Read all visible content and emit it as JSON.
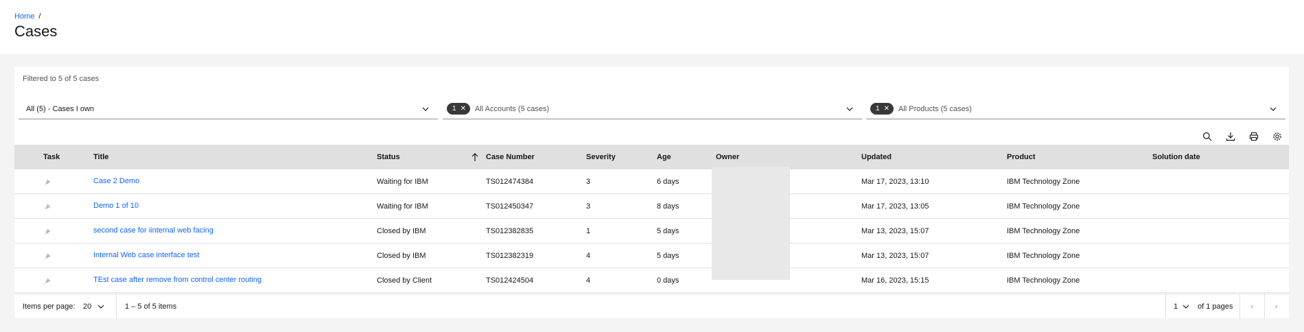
{
  "breadcrumb": {
    "home": "Home",
    "separator": "/"
  },
  "page": {
    "title": "Cases"
  },
  "filters": {
    "summary": "Filtered to 5 of 5 cases",
    "case_scope": "All (5) - Cases I own",
    "accounts": {
      "tag_count": "1",
      "label": "All Accounts (5 cases)"
    },
    "products": {
      "tag_count": "1",
      "label": "All Products (5 cases)"
    }
  },
  "toolbar": {
    "icons": [
      "search-icon",
      "download-icon",
      "print-icon",
      "settings-icon"
    ]
  },
  "table": {
    "headers": {
      "task": "Task",
      "title": "Title",
      "status": "Status",
      "case_number": "Case Number",
      "severity": "Severity",
      "age": "Age",
      "owner": "Owner",
      "updated": "Updated",
      "product": "Product",
      "solution_date": "Solution date"
    },
    "sort": {
      "column": "status",
      "direction": "ascending"
    },
    "rows": [
      {
        "title": "Case 2 Demo",
        "status": "Waiting for IBM",
        "case_number": "TS012474384",
        "severity": "3",
        "age": "6 days",
        "updated": "Mar 17, 2023, 13:10",
        "product": "IBM Technology Zone",
        "solution_date": ""
      },
      {
        "title": "Demo 1 of 10",
        "status": "Waiting for IBM",
        "case_number": "TS012450347",
        "severity": "3",
        "age": "8 days",
        "updated": "Mar 17, 2023, 13:05",
        "product": "IBM Technology Zone",
        "solution_date": ""
      },
      {
        "title": "second case for iinternal web facing",
        "status": "Closed by IBM",
        "case_number": "TS012382835",
        "severity": "1",
        "age": "5 days",
        "updated": "Mar 13, 2023, 15:07",
        "product": "IBM Technology Zone",
        "solution_date": ""
      },
      {
        "title": "Internal Web case interface test",
        "status": "Closed by IBM",
        "case_number": "TS012382319",
        "severity": "4",
        "age": "5 days",
        "updated": "Mar 13, 2023, 15:07",
        "product": "IBM Technology Zone",
        "solution_date": ""
      },
      {
        "title": "TEst case after remove from control center routing",
        "status": "Closed by Client",
        "case_number": "TS012424504",
        "severity": "4",
        "age": "0 days",
        "updated": "Mar 16, 2023, 15:15",
        "product": "IBM Technology Zone",
        "solution_date": ""
      }
    ]
  },
  "pagination": {
    "items_per_page_label": "Items per page:",
    "items_per_page": "20",
    "range": "1 – 5 of 5 items",
    "current_page": "1",
    "of_pages": "of 1 pages"
  }
}
